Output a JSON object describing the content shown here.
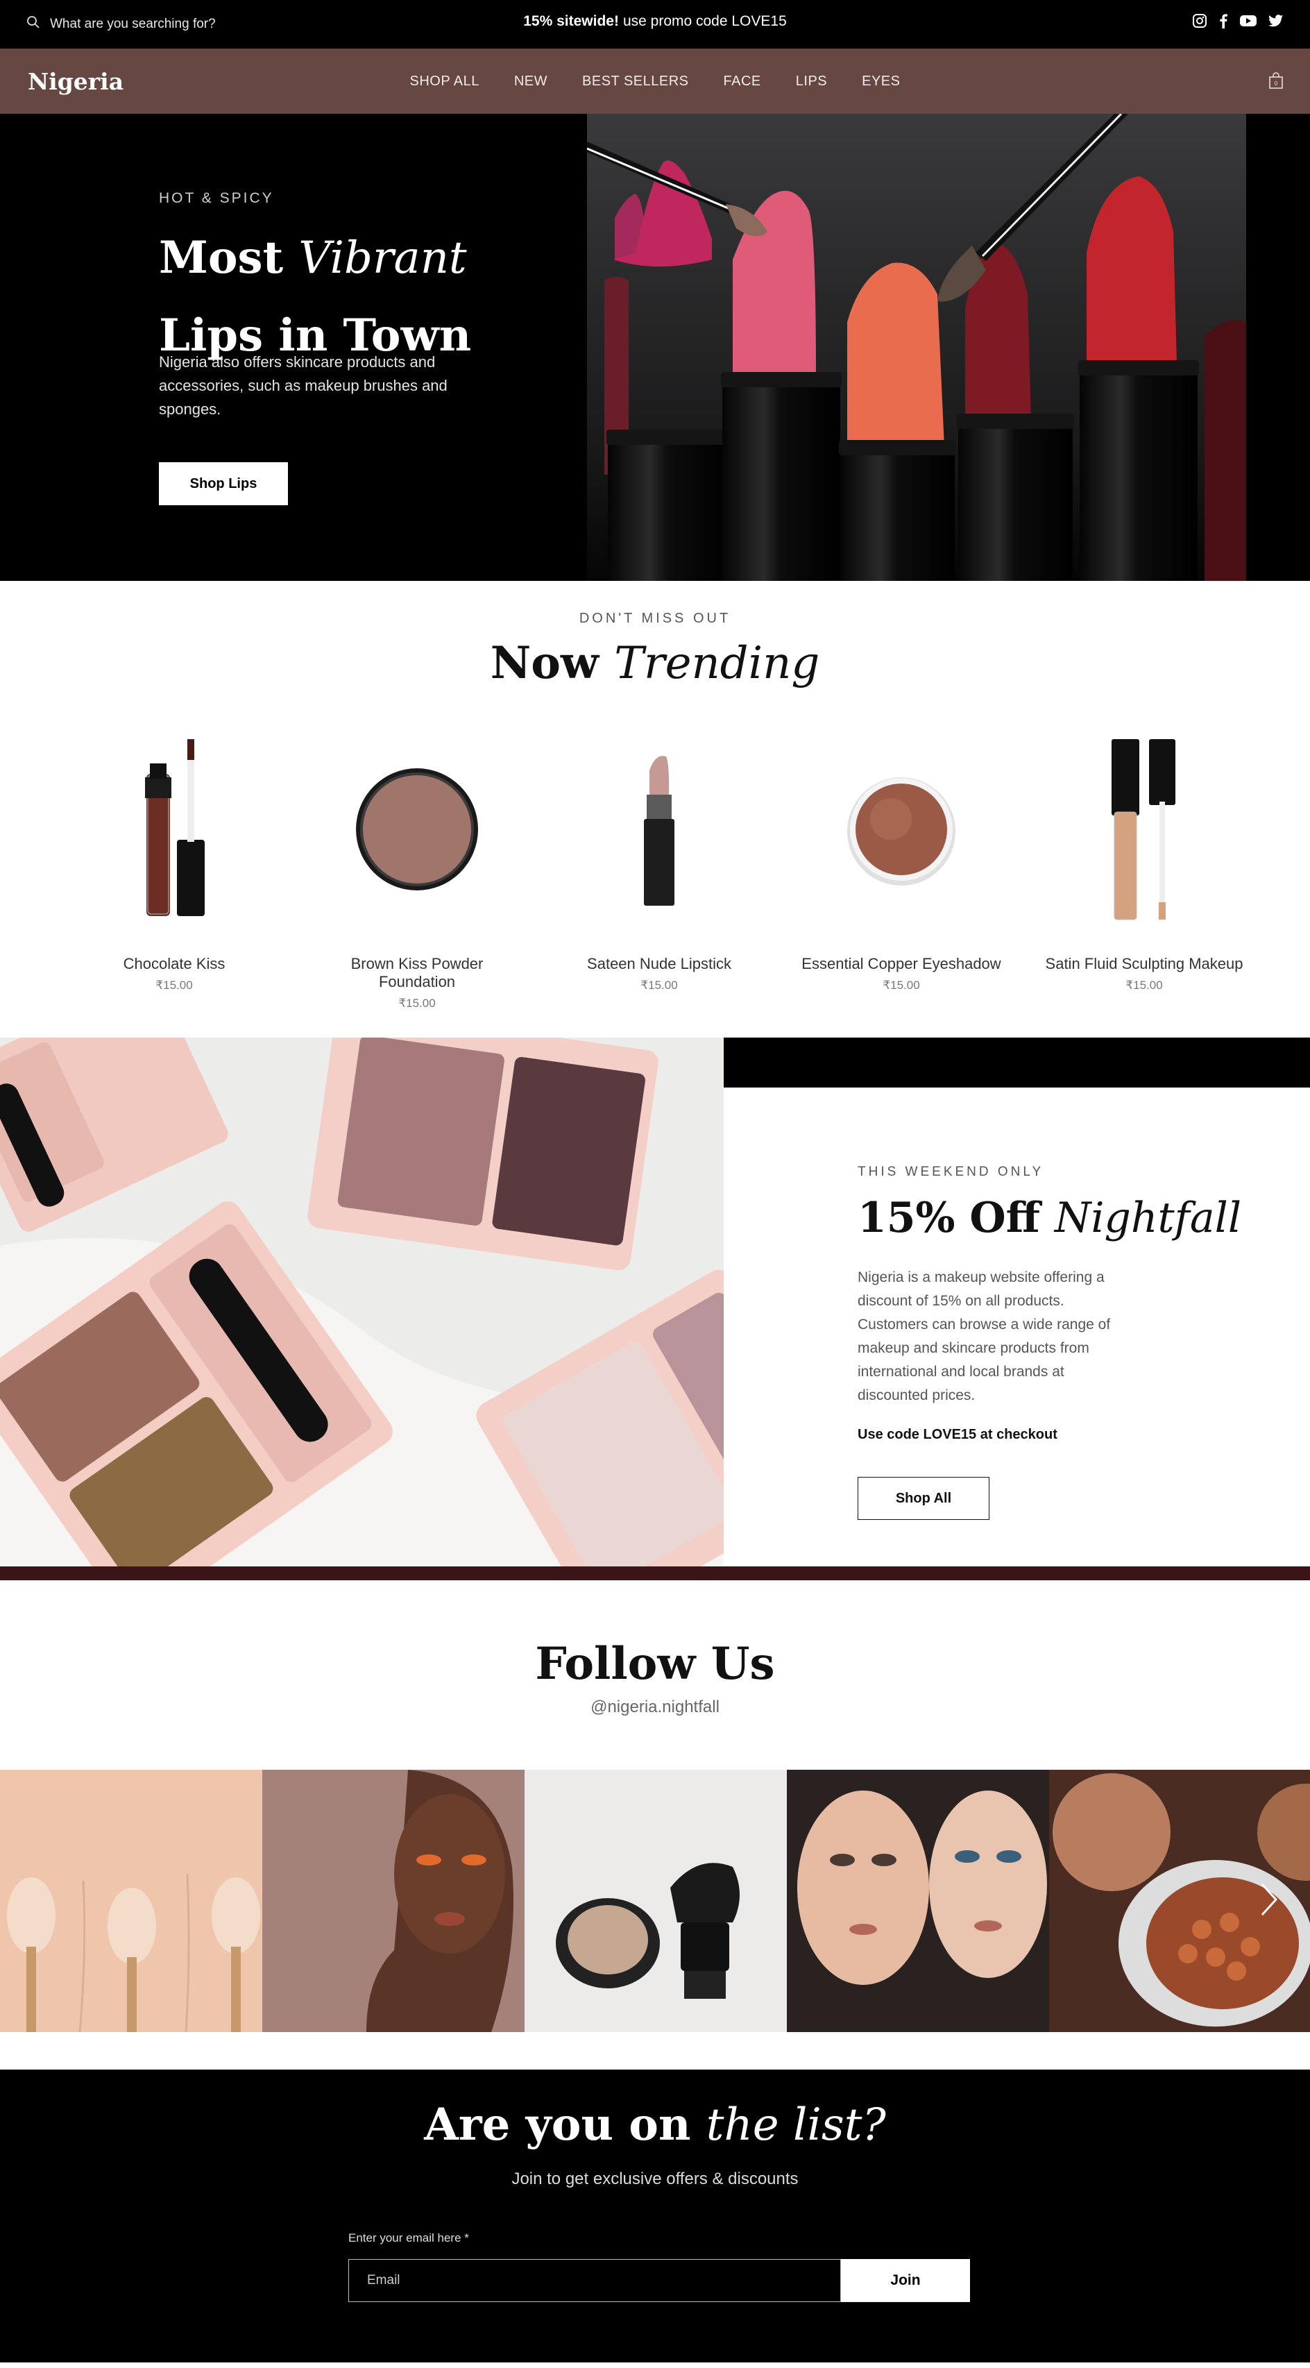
{
  "topbar": {
    "search_placeholder": "What are you searching for?",
    "promo_bold": "15% sitewide!",
    "promo_rest": "use promo code LOVE15",
    "social_icons": [
      "instagram-icon",
      "facebook-icon",
      "youtube-icon",
      "twitter-icon"
    ]
  },
  "nav": {
    "logo": "Nigeria",
    "items": [
      "SHOP ALL",
      "NEW",
      "BEST SELLERS",
      "FACE",
      "LIPS",
      "EYES"
    ],
    "cart_icon": "shopping-bag-icon",
    "bg_color": "#674742"
  },
  "hero": {
    "eyebrow": "HOT & SPICY",
    "title_a": "Most ",
    "title_b": "Vibrant",
    "title_c": "Lips in Town",
    "description": "Nigeria also offers skincare products and accessories, such as makeup brushes and sponges.",
    "button": "Shop Lips"
  },
  "trending": {
    "eyebrow": "DON'T MISS OUT",
    "title_a": "Now ",
    "title_b": "Trending",
    "products": [
      {
        "name": "Chocolate Kiss",
        "price": "₹15.00"
      },
      {
        "name": "Brown Kiss Powder Foundation",
        "price": "₹15.00"
      },
      {
        "name": "Sateen Nude Lipstick",
        "price": "₹15.00"
      },
      {
        "name": "Essential Copper Eyeshadow",
        "price": "₹15.00"
      },
      {
        "name": "Satin Fluid Sculpting Makeup",
        "price": "₹15.00"
      }
    ]
  },
  "promo": {
    "eyebrow": "THIS WEEKEND ONLY",
    "title_a": "15% Off ",
    "title_b": "Nightfall",
    "description": "Nigeria is a makeup website offering a discount of 15% on all products. Customers can browse a wide range of makeup and skincare products from international and local brands at discounted prices.",
    "code_text": "Use code LOVE15 at checkout",
    "button": "Shop All"
  },
  "follow": {
    "title": "Follow Us",
    "handle": "@nigeria.nightfall",
    "next_icon": "chevron-right-icon"
  },
  "newsletter": {
    "title_a": "Are you on ",
    "title_b": "the list?",
    "subtitle": "Join to get exclusive offers & discounts",
    "email_label": "Enter your email here *",
    "email_placeholder": "Email",
    "button": "Join"
  }
}
